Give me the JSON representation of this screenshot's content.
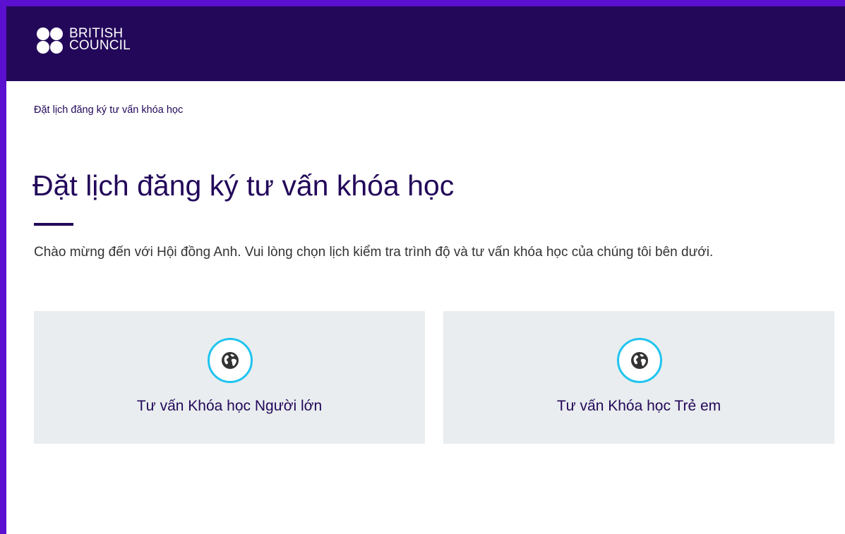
{
  "brand": {
    "logo_line1": "BRITISH",
    "logo_line2": "COUNCIL"
  },
  "breadcrumb": "Đặt lịch đăng ký tư vấn khóa học",
  "page": {
    "title": "Đặt lịch đăng ký tư vấn khóa học",
    "intro": "Chào mừng đến với Hội đồng Anh. Vui lòng chọn lịch kiểm tra trình độ và tư vấn khóa học của chúng tôi bên dưới."
  },
  "cards": [
    {
      "label": "Tư vấn Khóa học Người lớn",
      "icon": "globe-icon"
    },
    {
      "label": "Tư vấn Khóa học Trẻ em",
      "icon": "globe-icon"
    }
  ],
  "colors": {
    "header_bg": "#23085a",
    "frame_accent": "#5b0fcf",
    "card_bg": "#e9edef",
    "icon_ring": "#1fc4ef",
    "text_primary": "#23085a"
  }
}
